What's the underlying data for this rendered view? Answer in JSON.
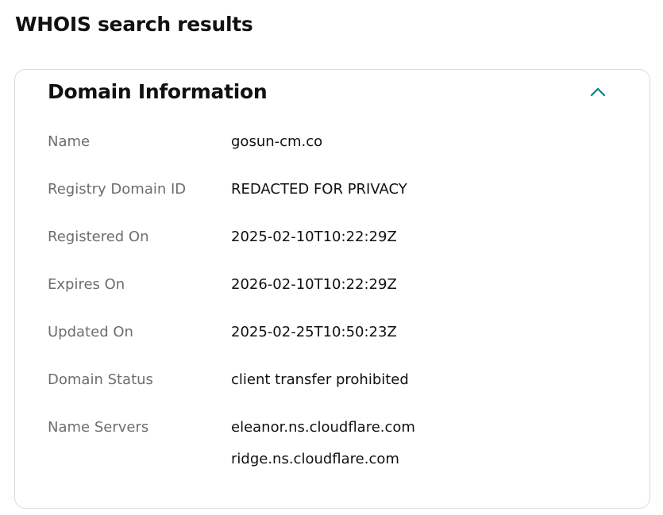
{
  "page": {
    "title": "WHOIS search results"
  },
  "domain_info": {
    "title": "Domain Information",
    "toggle_icon": "chevron-up-icon",
    "accent_color": "#00838c",
    "fields": {
      "name": {
        "label": "Name",
        "value": "gosun-cm.co"
      },
      "registry_domain_id": {
        "label": "Registry Domain ID",
        "value": "REDACTED FOR PRIVACY"
      },
      "registered_on": {
        "label": "Registered On",
        "value": "2025-02-10T10:22:29Z"
      },
      "expires_on": {
        "label": "Expires On",
        "value": "2026-02-10T10:22:29Z"
      },
      "updated_on": {
        "label": "Updated On",
        "value": "2025-02-25T10:50:23Z"
      },
      "domain_status": {
        "label": "Domain Status",
        "value": "client transfer prohibited"
      },
      "name_servers": {
        "label": "Name Servers",
        "values": [
          "eleanor.ns.cloudflare.com",
          "ridge.ns.cloudflare.com"
        ]
      }
    }
  }
}
